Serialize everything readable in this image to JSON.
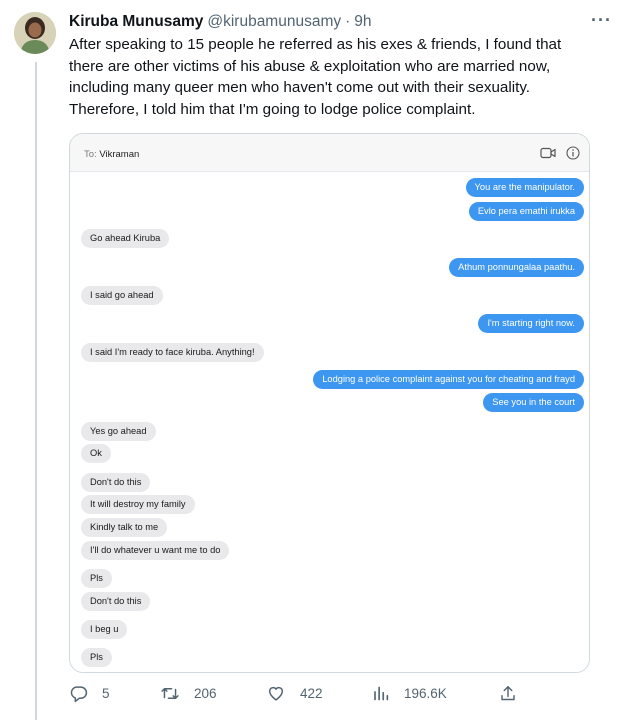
{
  "tweet": {
    "author_name": "Kiruba Munusamy",
    "handle": "@kirubamunusamy",
    "separator": "·",
    "time": "9h",
    "more_glyph": "···",
    "text": "After speaking to 15 people he referred as his exes & friends, I found that\nthere are other victims of his abuse & exploitation who are married now,\nincluding many queer men who haven't come out with their sexuality.\nTherefore, I told him that I'm going to lodge police complaint."
  },
  "conversation": {
    "to_label": "To:",
    "contact": "Vikraman",
    "messages": [
      {
        "from": "me",
        "text": "You are the manipulator."
      },
      {
        "from": "me",
        "text": "Evlo pera emathi irukka"
      },
      {
        "from": "them",
        "text": "Go ahead Kiruba"
      },
      {
        "from": "me",
        "text": "Athum ponnungalaa paathu."
      },
      {
        "from": "them",
        "text": "I said go ahead"
      },
      {
        "from": "me",
        "text": "I'm starting right now."
      },
      {
        "from": "them",
        "text": "I said I'm ready to face kiruba. Anything!"
      },
      {
        "from": "me",
        "text": "Lodging a police complaint against you for cheating and frayd"
      },
      {
        "from": "me",
        "text": "See you in the court"
      },
      {
        "from": "them",
        "text": "Yes go ahead"
      },
      {
        "from": "them",
        "text": "Ok"
      },
      {
        "from": "them",
        "text": "Don't do this"
      },
      {
        "from": "them",
        "text": "It will destroy my family"
      },
      {
        "from": "them",
        "text": "Kindly talk to me"
      },
      {
        "from": "them",
        "text": "I'll do whatever u want me to do"
      },
      {
        "from": "them",
        "text": "Pls"
      },
      {
        "from": "them",
        "text": "Don't do this"
      },
      {
        "from": "them",
        "text": "I beg u"
      },
      {
        "from": "them",
        "text": "Pls"
      }
    ]
  },
  "actions": {
    "replies": "5",
    "retweets": "206",
    "likes": "422",
    "views": "196.6K"
  },
  "colors": {
    "sent_bubble": "#3d96f0",
    "received_bubble": "#e9e9eb",
    "muted_text": "#536471"
  },
  "icons": {
    "reply": "reply-icon",
    "retweet": "retweet-icon",
    "like": "heart-icon",
    "views": "views-icon",
    "share": "share-icon",
    "video": "video-camera-icon",
    "info": "info-icon"
  }
}
